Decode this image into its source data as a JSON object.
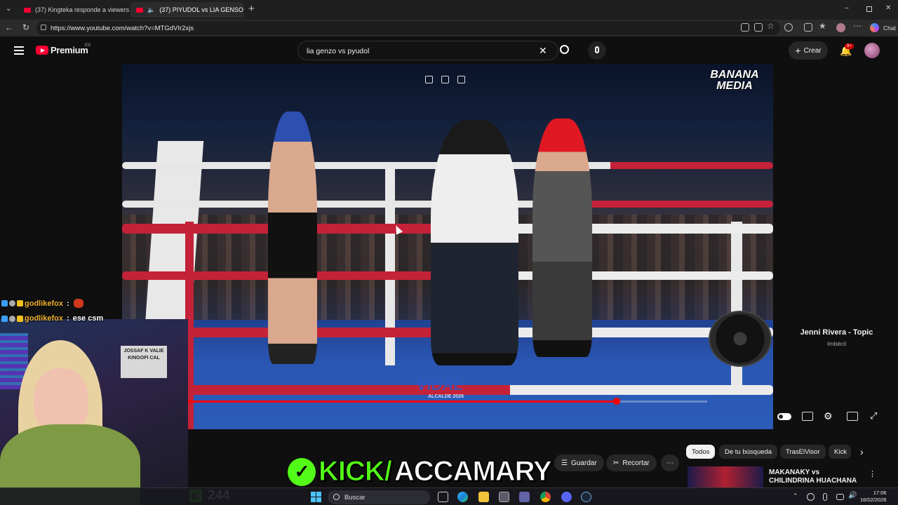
{
  "browser": {
    "tabs": [
      {
        "label": "(37) Kingteka responde a viewers d"
      },
      {
        "label": "(37) PIYUDOL vs LIA GENSO |"
      }
    ],
    "url": "https://www.youtube.com/watch?v=MTGdVIr2xjs",
    "chat_label": "Chat"
  },
  "youtube": {
    "logo_text": "Premium",
    "region": "ES",
    "search_value": "lia genzo vs pyudol",
    "create_label": "Crear",
    "notif_count": "9+"
  },
  "video": {
    "watermark": "BANANA MEDIA",
    "banner_text": "VIDAL",
    "banner_sub": "ALCALDE 2026",
    "progress_fraction": 0.82
  },
  "now_playing": {
    "title": "Jenni Rivera - Topic",
    "subtitle": "Imbécil"
  },
  "actions": {
    "save": "Guardar",
    "clip": "Recortar"
  },
  "chips": [
    "Todos",
    "De tu búsqueda",
    "TrasElVisor",
    "Kick"
  ],
  "recommended": {
    "title": "MAKANAKY vs CHILINDRINA HUACHANA | VELADA DE ATE"
  },
  "stream": {
    "chat": [
      {
        "user": "godlikefox",
        "msg": ""
      },
      {
        "user": "godlikefox",
        "msg": "ese csm"
      }
    ],
    "kick_prefix": "KICK/",
    "kick_name": "ACCAMARY",
    "viewers": "244",
    "sign_text": "JOSSAF K VALIE KINGOFI CAL"
  },
  "taskbar": {
    "search_placeholder": "Buscar",
    "time": "17:06",
    "date": "16/02/2026"
  },
  "colors": {
    "youtube_red": "#ff0033",
    "kick_green": "#53fc18"
  }
}
